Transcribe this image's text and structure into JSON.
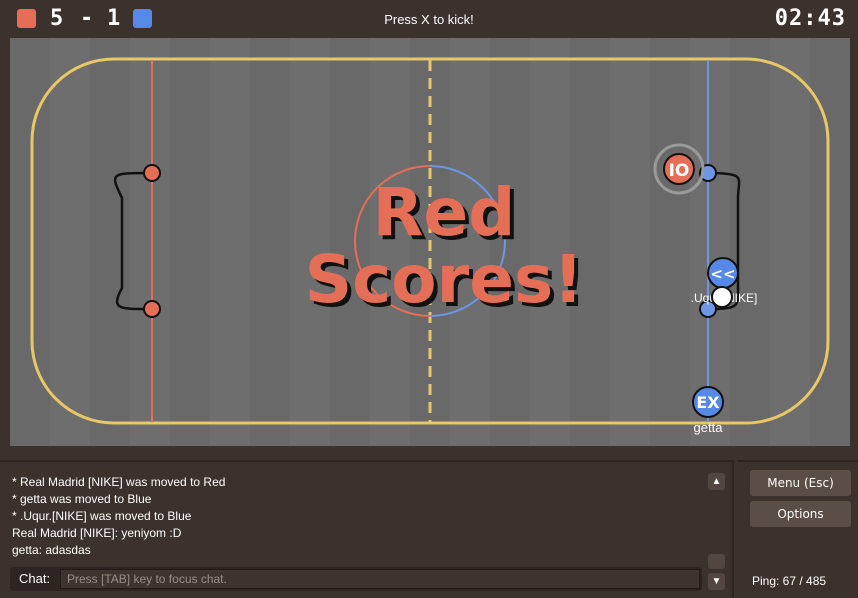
{
  "header": {
    "red_color": "#e56e56",
    "blue_color": "#5689e5",
    "red_score": "5",
    "separator": "-",
    "blue_score": "1",
    "hint": "Press X to kick!",
    "clock": "02:43"
  },
  "field": {
    "announcement_line1": "Red",
    "announcement_line2": "Scores!",
    "players": [
      {
        "team": "red",
        "avatar": "IO",
        "name": ""
      },
      {
        "team": "blue",
        "avatar": "<<",
        "name": ".Uqur.[NIKE]"
      },
      {
        "team": "blue",
        "avatar": "EX",
        "name": "getta"
      }
    ]
  },
  "chat": {
    "messages": [
      "* Real Madrid [NIKE] was moved to Red",
      "* getta was moved to Blue",
      "* .Uqur.[NIKE] was moved to Blue",
      "Real Madrid [NIKE]: yeniyom :D",
      "getta: adasdas"
    ],
    "label": "Chat:",
    "placeholder": "Press [TAB] key to focus chat.",
    "scroll_up_icon": "▲",
    "scroll_down_icon": "▼"
  },
  "side": {
    "menu_label": "Menu (Esc)",
    "options_label": "Options",
    "ping": "Ping: 67 / 485"
  }
}
